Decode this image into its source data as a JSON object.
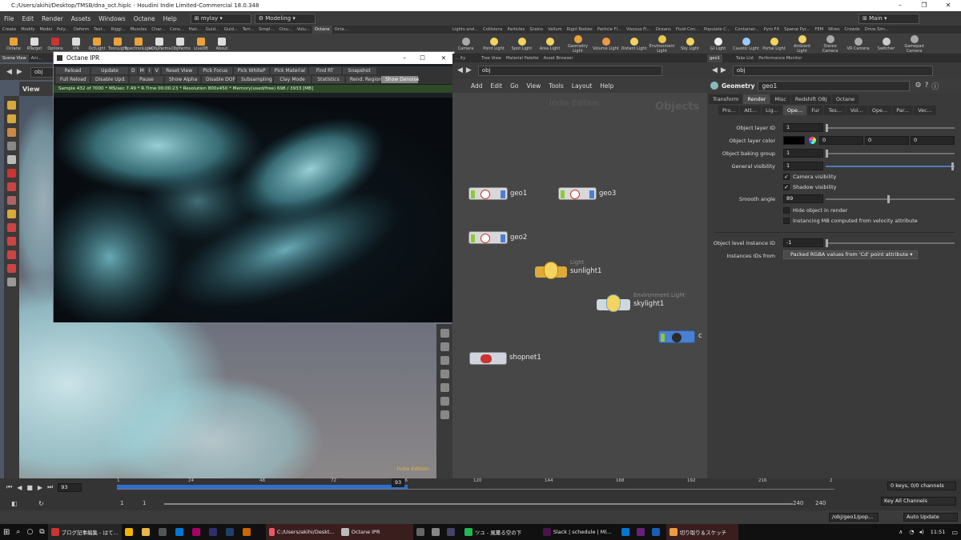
{
  "window": {
    "title": "C:/Users/akihi/Desktop/TMSB/dna_oct.hiplc - Houdini Indie Limited-Commercial 18.0.348"
  },
  "menu": {
    "items": [
      "File",
      "Edit",
      "Render",
      "Assets",
      "Windows",
      "Octane",
      "Help"
    ],
    "desktop": "mylay",
    "context": "Modeling",
    "main": "Main"
  },
  "shelf_left": {
    "tabs": [
      "Create",
      "Modify",
      "Model",
      "Poly...",
      "Deform",
      "Text...",
      "Riggi...",
      "Muscles",
      "Char...",
      "Cons...",
      "Hair...",
      "Guid...",
      "Guid...",
      "Terr...",
      "Simpl...",
      "Clou...",
      "Volu...",
      "Octane",
      "Octa..."
    ],
    "active_tab": "Octane",
    "tools": [
      "Octane",
      "RTarget",
      "Options",
      "IPR",
      "OctLight",
      "ToonLight",
      "SpectronLight",
      "+ObjParms",
      "-ObjParms",
      "LiveDB",
      "About"
    ]
  },
  "shelf_right": {
    "tabs": [
      "Lights and...",
      "Collisions",
      "Particles",
      "Grains",
      "Vellum",
      "Rigid Bodies",
      "Particle Fl...",
      "Viscous Fl...",
      "Oceans",
      "Fluid Con...",
      "Populate C...",
      "Container...",
      "Pyro FX",
      "Sparse Pyr...",
      "FEM",
      "Wires",
      "Crowds",
      "Drive Sim..."
    ],
    "tools": [
      "Camera",
      "Point Light",
      "Spot Light",
      "Area Light",
      "Geometry Light",
      "Volume Light",
      "Distant Light",
      "Environment Light",
      "Sky Light",
      "GI Light",
      "Caustic Light",
      "Portal Light",
      "Ambient Light",
      "Stereo Camera",
      "VR Camera",
      "Switcher",
      "Gamepad Camera"
    ]
  },
  "left_pane": {
    "tabs": [
      "Scene View",
      "Ani..."
    ],
    "path": "obj",
    "view_label": "View",
    "watermark": "Indie Edition"
  },
  "ipr": {
    "title": "Octane IPR",
    "row1": [
      "Reload",
      "Update",
      "D",
      "M",
      "I",
      "V",
      "Reset View",
      "Pick Focus",
      "Pick WhiteP",
      "Pick Material",
      "Find RT",
      "Snapshot"
    ],
    "row2": [
      "Full Reload",
      "Disable Upd.",
      "Pause",
      "Show Alpha",
      "Disable DOF",
      "Subsampling",
      "Clay Mode",
      "Statistics",
      "Rend. Region",
      "Show Denoise"
    ],
    "status": "Sample 432 of 7000 * MS/sec 7.49 * R.Time 00:00:23 * Resolution 800x450 * Memory(used/free) 698 / 3933 [MB]"
  },
  "network": {
    "tabs": [
      "... ity",
      "Tree View",
      "Material Palette",
      "Asset Browser"
    ],
    "path": "obj",
    "menu": [
      "Add",
      "Edit",
      "Go",
      "View",
      "Tools",
      "Layout",
      "Help"
    ],
    "watermark": "Indie Edition",
    "context_label": "Objects",
    "nodes": [
      {
        "name": "geo1",
        "type": ""
      },
      {
        "name": "geo3",
        "type": ""
      },
      {
        "name": "geo2",
        "type": ""
      },
      {
        "name": "sunlight1",
        "type": "Light"
      },
      {
        "name": "skylight1",
        "type": "Environment Light"
      },
      {
        "name": "shopnet1",
        "type": ""
      },
      {
        "name": "c",
        "type": ""
      }
    ]
  },
  "params": {
    "tabs": [
      "geo1",
      "Take List",
      "Performance Monitor"
    ],
    "path": "obj",
    "node_type": "Geometry",
    "node_name": "geo1",
    "main_tabs": [
      "Transform",
      "Render",
      "Misc",
      "Redshift OBJ",
      "Octane"
    ],
    "active_main": "Render",
    "sub_tabs": [
      "Pro...",
      "Att...",
      "Lig...",
      "Ope...",
      "Fur",
      "Tes...",
      "Vol...",
      "Ope...",
      "Par...",
      "Vec..."
    ],
    "fields": {
      "object_layer_id": {
        "label": "Object layer ID",
        "value": "1"
      },
      "object_layer_color": {
        "label": "Object layer color",
        "r": "0",
        "g": "0",
        "b": "0"
      },
      "object_baking_group": {
        "label": "Object baking group",
        "value": "1"
      },
      "general_visibility": {
        "label": "General visibility",
        "value": "1"
      },
      "camera_visibility": "Camera visibility",
      "shadow_visibility": "Shadow visibility",
      "smooth_angle": {
        "label": "Smooth angle",
        "value": "89"
      },
      "hide_object": "Hide object in render",
      "instancing_mb": "Instancing MB computed from velocity attribute",
      "object_instance_id": {
        "label": "Object level instance ID",
        "value": "-1"
      },
      "instance_ids_from": {
        "label": "Instances IDs from",
        "value": "Packed RGBA values from 'Cd' point attribute"
      }
    }
  },
  "timeline": {
    "current_frame": "93",
    "ticks": [
      "1",
      "24",
      "48",
      "72",
      "96",
      "120",
      "144",
      "168",
      "192",
      "216",
      "2"
    ],
    "range_start": "1",
    "range_start2": "1",
    "range_end": "240",
    "range_end2": "240",
    "keys_info": "0 keys, 0/0 channels",
    "key_all": "Key All Channels",
    "playhead_fraction": 0.385
  },
  "statusbar": {
    "path": "/obj/geo1/pop...",
    "auto_update": "Auto Update"
  },
  "taskbar": {
    "items": [
      "ブログ記事編集 - はて...",
      "C:/Users/akihi/Deskt...",
      "Octane IPR",
      "ツユ - 風薫る空の下",
      "Slack | schedule | Ml...",
      "切り取り＆スケッチ"
    ],
    "time": "11:51"
  }
}
